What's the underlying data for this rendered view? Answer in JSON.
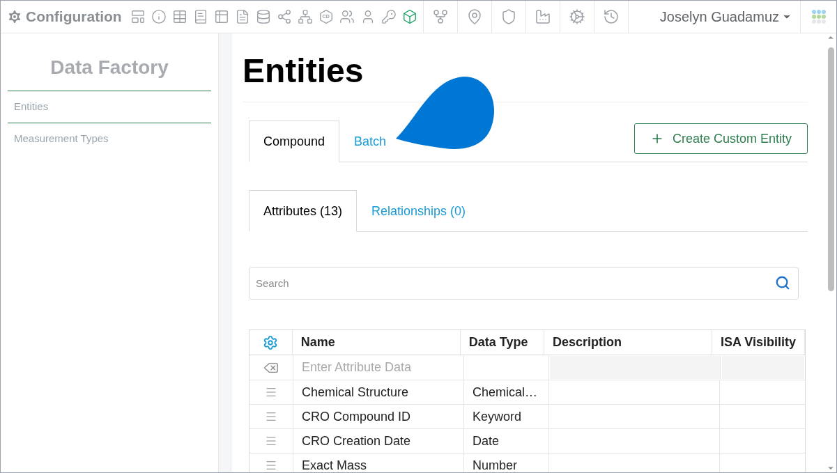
{
  "header": {
    "title": "Configuration",
    "toolbar": [
      {
        "kind": "form",
        "selected": false
      },
      {
        "kind": "info",
        "selected": false
      },
      {
        "kind": "table",
        "selected": false
      },
      {
        "kind": "book",
        "selected": false
      },
      {
        "kind": "grid",
        "selected": false
      },
      {
        "kind": "document",
        "selected": false
      },
      {
        "kind": "database",
        "selected": false
      },
      {
        "kind": "share",
        "selected": false
      },
      {
        "kind": "network",
        "selected": false
      },
      {
        "kind": "badge",
        "label": "CD",
        "selected": false
      },
      {
        "kind": "users",
        "selected": false
      },
      {
        "kind": "user",
        "selected": false
      },
      {
        "kind": "key",
        "selected": false
      },
      {
        "kind": "cube",
        "selected": true
      }
    ],
    "tools": [
      {
        "kind": "workflow"
      },
      {
        "kind": "pin"
      },
      {
        "kind": "shield"
      },
      {
        "kind": "factory"
      },
      {
        "kind": "cogs"
      },
      {
        "kind": "history"
      }
    ],
    "user": "Joselyn Guadamuz"
  },
  "sidebar": {
    "title": "Data Factory",
    "items": [
      {
        "label": "Entities",
        "selected": true
      },
      {
        "label": "Measurement Types",
        "selected": false
      }
    ]
  },
  "main": {
    "title": "Entities",
    "entity_tabs": [
      {
        "label": "Compound",
        "selected": true
      },
      {
        "label": "Batch",
        "selected": false
      }
    ],
    "create_button": "Create Custom Entity",
    "attribute_tabs": [
      {
        "label": "Attributes (13)",
        "selected": true
      },
      {
        "label": "Relationships (0)",
        "selected": false
      }
    ],
    "search": {
      "placeholder": "Search"
    },
    "table": {
      "columns": [
        "Name",
        "Data Type",
        "Description",
        "ISA Visibility"
      ],
      "entry_row": {
        "placeholder": "Enter Attribute Data"
      },
      "rows": [
        {
          "name": "Chemical Structure",
          "data_type": "Chemical…"
        },
        {
          "name": "CRO Compound ID",
          "data_type": "Keyword"
        },
        {
          "name": "CRO Creation Date",
          "data_type": "Date"
        },
        {
          "name": "Exact Mass",
          "data_type": "Number"
        }
      ]
    }
  }
}
